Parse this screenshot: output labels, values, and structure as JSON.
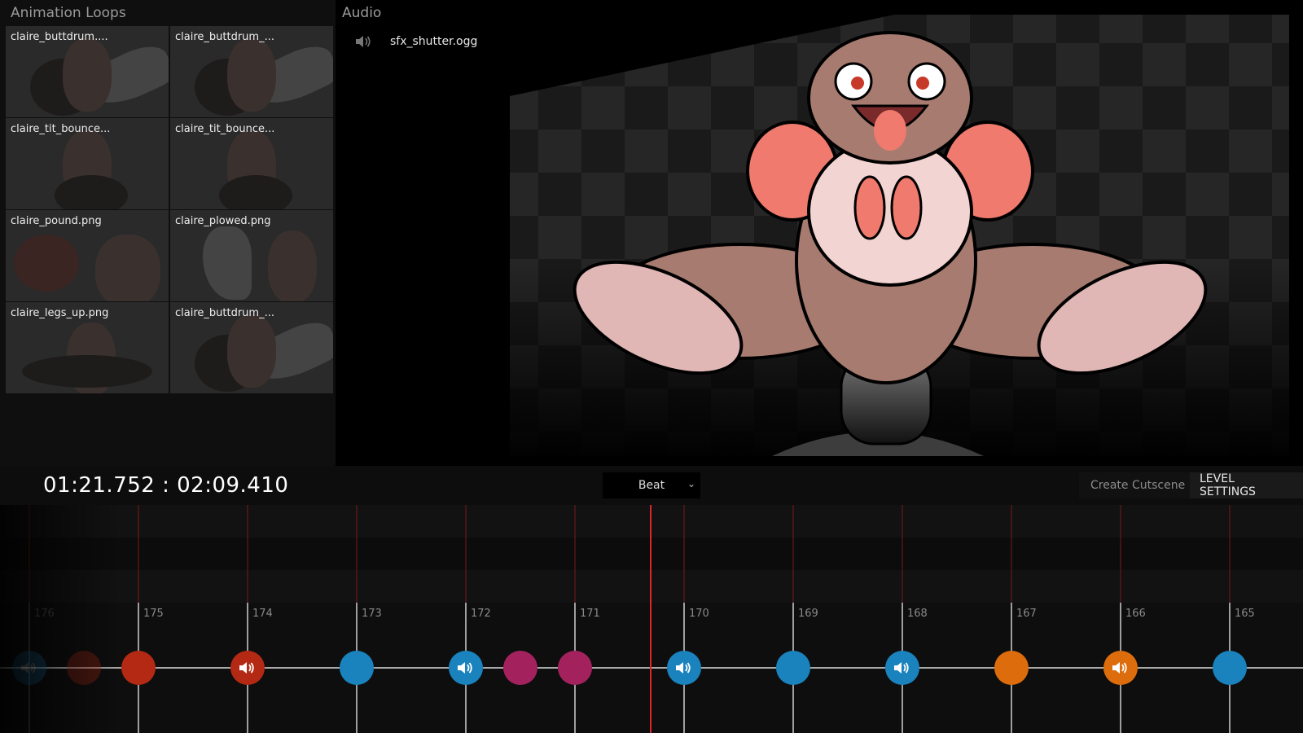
{
  "loops": {
    "title": "Animation Loops",
    "items": [
      {
        "label": "claire_buttdrum...."
      },
      {
        "label": "claire_buttdrum_..."
      },
      {
        "label": "claire_tit_bounce..."
      },
      {
        "label": "claire_tit_bounce..."
      },
      {
        "label": "claire_pound.png"
      },
      {
        "label": "claire_plowed.png"
      },
      {
        "label": "claire_legs_up.png"
      },
      {
        "label": "claire_buttdrum_..."
      }
    ]
  },
  "audio": {
    "title": "Audio",
    "file": "sfx_shutter.ogg",
    "icon": "speaker-icon"
  },
  "toolbar": {
    "timecode": "01:21.752 : 02:09.410",
    "snap_value": "Beat",
    "create_cutscene": "Create Cutscene",
    "level_settings": "LEVEL SETTINGS"
  },
  "timeline": {
    "beats": [
      "176",
      "175",
      "174",
      "173",
      "172",
      "171",
      "170",
      "169",
      "168",
      "167",
      "166",
      "165"
    ],
    "colors": {
      "red": "#b32914",
      "blue": "#1a82bd",
      "magenta": "#a3225e",
      "orange": "#dd6d0c",
      "playhead": "#e0242a"
    },
    "markers": [
      {
        "beat": 176,
        "offset": 0,
        "color": "blue",
        "sound": true,
        "faded": true
      },
      {
        "beat": 176,
        "offset": 0.5,
        "color": "red",
        "sound": false,
        "faded": true
      },
      {
        "beat": 175,
        "offset": 0,
        "color": "red",
        "sound": false,
        "faded": false
      },
      {
        "beat": 174,
        "offset": 0,
        "color": "red",
        "sound": true,
        "faded": false
      },
      {
        "beat": 173,
        "offset": 0,
        "color": "blue",
        "sound": false,
        "faded": false
      },
      {
        "beat": 172,
        "offset": 0,
        "color": "blue",
        "sound": true,
        "faded": false
      },
      {
        "beat": 172,
        "offset": 0.5,
        "color": "magenta",
        "sound": false,
        "faded": false
      },
      {
        "beat": 171,
        "offset": 0,
        "color": "magenta",
        "sound": false,
        "faded": false
      },
      {
        "beat": 170,
        "offset": 0,
        "color": "blue",
        "sound": true,
        "faded": false
      },
      {
        "beat": 169,
        "offset": 0,
        "color": "blue",
        "sound": false,
        "faded": false
      },
      {
        "beat": 168,
        "offset": 0,
        "color": "blue",
        "sound": true,
        "faded": false
      },
      {
        "beat": 167,
        "offset": 0,
        "color": "orange",
        "sound": false,
        "faded": false
      },
      {
        "beat": 166,
        "offset": 0,
        "color": "orange",
        "sound": true,
        "faded": false
      },
      {
        "beat": 165,
        "offset": 0,
        "color": "blue",
        "sound": false,
        "faded": false
      }
    ]
  }
}
